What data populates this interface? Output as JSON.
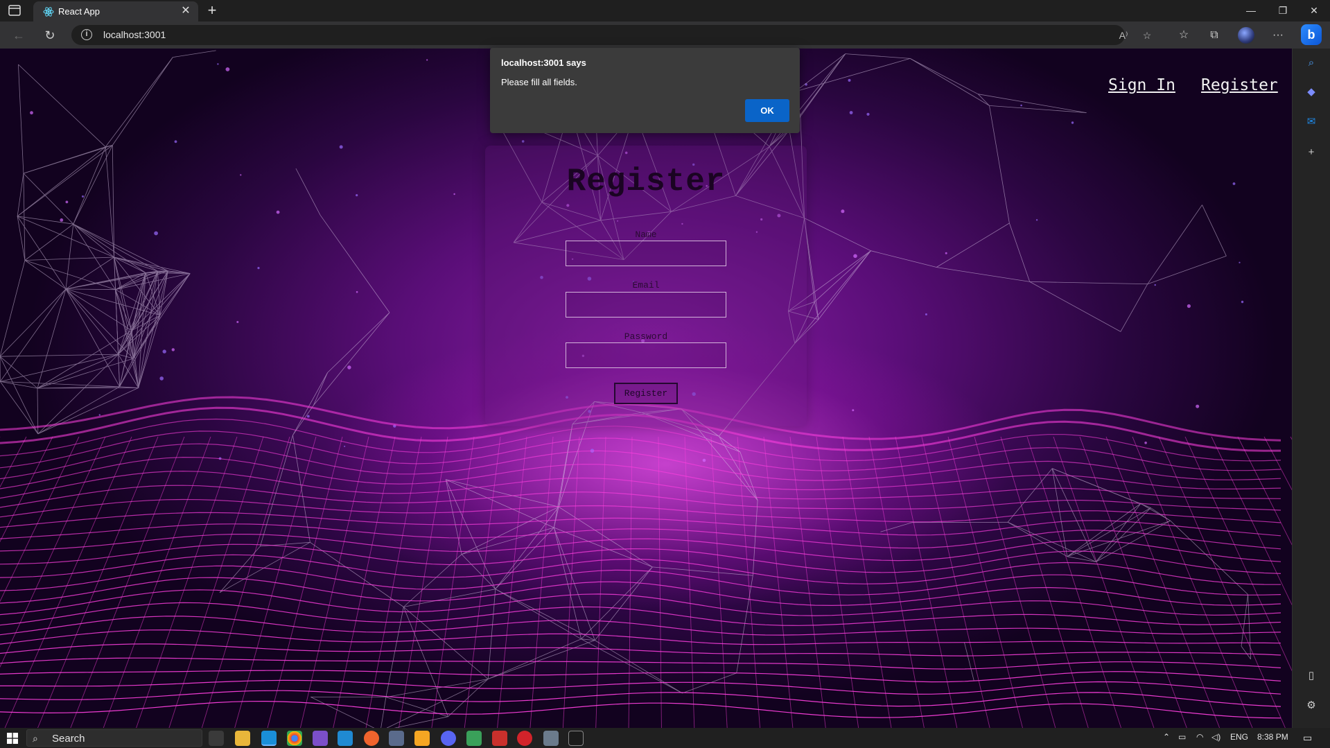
{
  "browser": {
    "tab_title": "React App",
    "url": "localhost:3001",
    "read_aloud_label": "A⁾"
  },
  "page": {
    "nav_signin": "Sign In",
    "nav_register": "Register",
    "form_title": "Register",
    "labels": {
      "name": "Name",
      "email": "Email",
      "password": "Password"
    },
    "submit": "Register"
  },
  "alert": {
    "title": "localhost:3001 says",
    "message": "Please fill all fields.",
    "ok": "OK"
  },
  "taskbar": {
    "search_placeholder": "Search",
    "lang": "ENG",
    "time": "8:38 PM"
  },
  "colors": {
    "accent": "#0a64c8",
    "bg_purple": "#5a0e78",
    "wave_pink": "#ff3fe0"
  }
}
